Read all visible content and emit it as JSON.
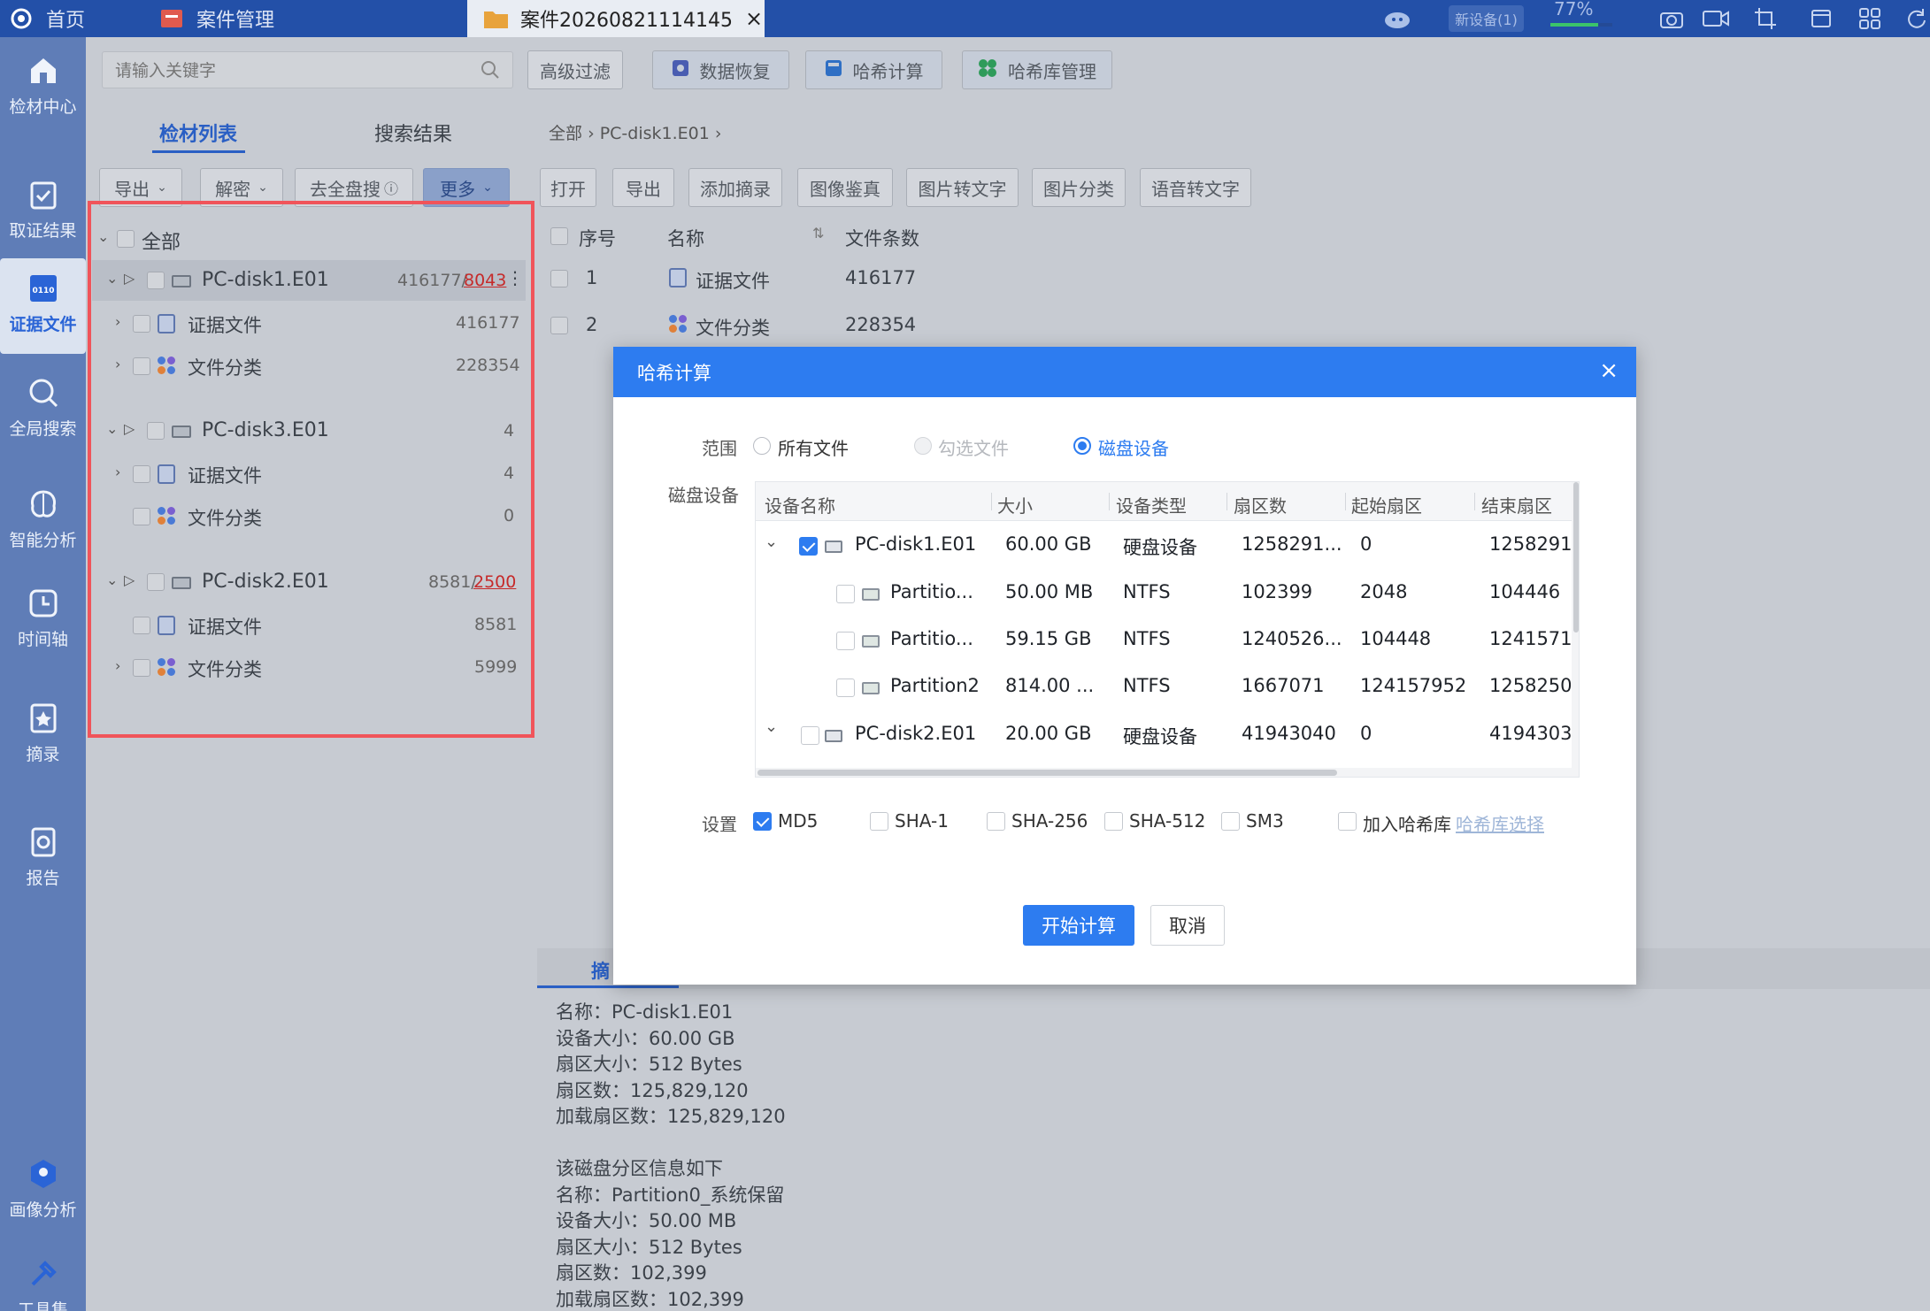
{
  "topbar": {
    "home_label": "首页",
    "case_label": "案件管理",
    "active_tab_label": "案件20260821114145",
    "active_tab_close": "×",
    "device_label": "新设备(1)",
    "battery_label": "77%"
  },
  "leftnav": {
    "items": [
      {
        "label": "检材中心",
        "icon": "home-icon"
      },
      {
        "label": "取证结果",
        "icon": "clipboard-check-icon"
      },
      {
        "label": "证据文件",
        "icon": "binary-file-icon"
      },
      {
        "label": "全局搜索",
        "icon": "search-icon"
      },
      {
        "label": "智能分析",
        "icon": "brain-icon"
      },
      {
        "label": "时间轴",
        "icon": "clock-icon"
      },
      {
        "label": "摘录",
        "icon": "bookmark-star-icon"
      },
      {
        "label": "报告",
        "icon": "report-icon"
      },
      {
        "label": "画像分析",
        "icon": "portrait-icon"
      },
      {
        "label": "工具集",
        "icon": "tools-icon"
      }
    ]
  },
  "toolbar": {
    "search_placeholder": "请输入关键字",
    "advanced_filter": "高级过滤",
    "data_recovery": "数据恢复",
    "hash_calc": "哈希计算",
    "hash_lib": "哈希库管理"
  },
  "left_panel": {
    "tab_list": "检材列表",
    "tab_search": "搜索结果",
    "btn_export": "导出",
    "btn_decrypt": "解密",
    "btn_fullscan": "去全盘搜",
    "btn_more": "更多",
    "tree_all": "全部",
    "disks": [
      {
        "name": "PC-disk1.E01",
        "count": "416177/",
        "count_red": "8043",
        "children": [
          {
            "name": "证据文件",
            "count": "416177",
            "type": "doc"
          },
          {
            "name": "文件分类",
            "count": "228354",
            "type": "cls"
          }
        ]
      },
      {
        "name": "PC-disk3.E01",
        "count": "4",
        "count_red": "",
        "children": [
          {
            "name": "证据文件",
            "count": "4",
            "type": "doc"
          },
          {
            "name": "文件分类",
            "count": "0",
            "type": "cls"
          }
        ]
      },
      {
        "name": "PC-disk2.E01",
        "count": "8581/",
        "count_red": "2500",
        "children": [
          {
            "name": "证据文件",
            "count": "8581",
            "type": "doc"
          },
          {
            "name": "文件分类",
            "count": "5999",
            "type": "cls"
          }
        ]
      }
    ]
  },
  "right_panel": {
    "breadcrumb_all": "全部",
    "breadcrumb_disk": "PC-disk1.E01",
    "actions": [
      "打开",
      "导出",
      "添加摘录",
      "图像鉴真",
      "图片转文字",
      "图片分类",
      "语音转文字"
    ],
    "table_headers": [
      "序号",
      "名称",
      "文件条数"
    ],
    "rows": [
      {
        "index": "1",
        "name": "证据文件",
        "count": "416177"
      },
      {
        "index": "2",
        "name": "文件分类",
        "count": "228354"
      }
    ],
    "detail_tab": "摘",
    "detail_lines": [
      "名称：PC-disk1.E01",
      "设备大小：60.00 GB",
      "扇区大小：512 Bytes",
      "扇区数：125,829,120",
      "加载扇区数：125,829,120",
      "",
      "该磁盘分区信息如下",
      "名称：Partition0_系统保留",
      "设备大小：50.00 MB",
      "扇区大小：512 Bytes",
      "扇区数：102,399",
      "加载扇区数：102,399"
    ]
  },
  "modal": {
    "title": "哈希计算",
    "close": "×",
    "scope_label": "范围",
    "scope_all": "所有文件",
    "scope_checked": "勾选文件",
    "scope_disk": "磁盘设备",
    "disk_label": "磁盘设备",
    "headers": [
      "设备名称",
      "大小",
      "设备类型",
      "扇区数",
      "起始扇区",
      "结束扇区"
    ],
    "rows": [
      {
        "name": "PC-disk1.E01",
        "size": "60.00 GB",
        "type": "硬盘设备",
        "sectors": "1258291...",
        "start": "0",
        "end": "1258291",
        "checked": true,
        "level": 0
      },
      {
        "name": "Partitio...",
        "size": "50.00 MB",
        "type": "NTFS",
        "sectors": "102399",
        "start": "2048",
        "end": "104446",
        "checked": false,
        "level": 1
      },
      {
        "name": "Partitio...",
        "size": "59.15 GB",
        "type": "NTFS",
        "sectors": "1240526...",
        "start": "104448",
        "end": "1241571",
        "checked": false,
        "level": 1
      },
      {
        "name": "Partition2",
        "size": "814.00 ...",
        "type": "NTFS",
        "sectors": "1667071",
        "start": "124157952",
        "end": "1258250",
        "checked": false,
        "level": 1
      },
      {
        "name": "PC-disk2.E01",
        "size": "20.00 GB",
        "type": "硬盘设备",
        "sectors": "41943040",
        "start": "0",
        "end": "4194303",
        "checked": false,
        "level": 0
      }
    ],
    "settings_label": "设置",
    "opt_md5": "MD5",
    "opt_sha1": "SHA-1",
    "opt_sha256": "SHA-256",
    "opt_sha512": "SHA-512",
    "opt_sm3": "SM3",
    "opt_addlib": "加入哈希库",
    "opt_libselect": "哈希库选择",
    "btn_start": "开始计算",
    "btn_cancel": "取消"
  },
  "colors": {
    "accent": "#2d7cf0",
    "topbar": "#2350a8",
    "nav": "#5f7db7",
    "highlight_border": "#f0545a"
  }
}
